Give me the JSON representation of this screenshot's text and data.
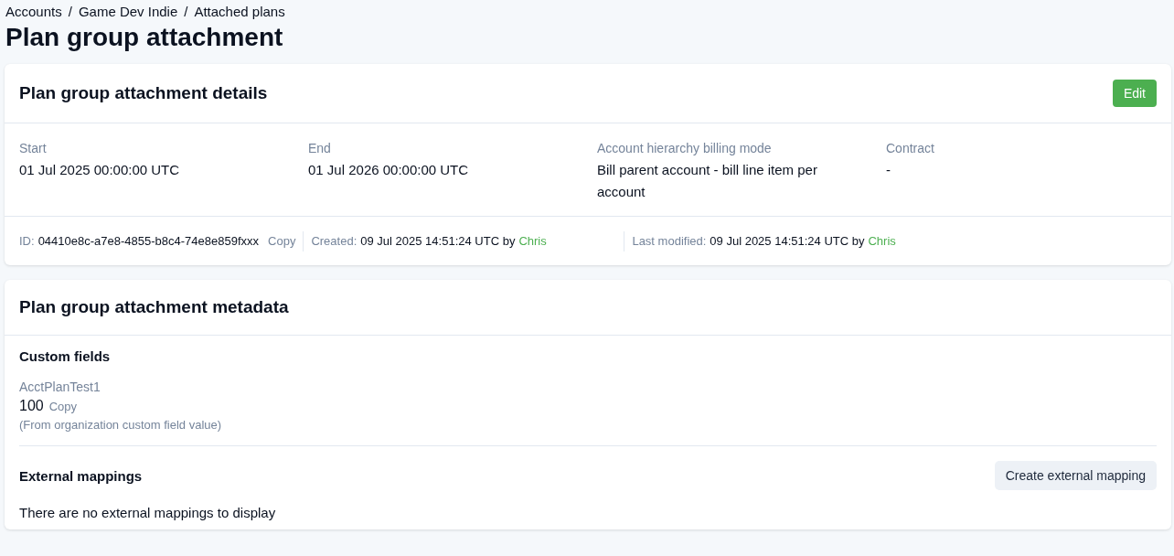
{
  "breadcrumb": {
    "separator": "/",
    "items": [
      {
        "label": "Accounts"
      },
      {
        "label": "Game Dev Indie"
      },
      {
        "label": "Attached plans"
      }
    ]
  },
  "page_title": "Plan group attachment",
  "details": {
    "title": "Plan group attachment details",
    "edit_button": "Edit",
    "fields": [
      {
        "label": "Start",
        "value": "01 Jul 2025 00:00:00 UTC"
      },
      {
        "label": "End",
        "value": "01 Jul 2026 00:00:00 UTC"
      },
      {
        "label": "Account hierarchy billing mode",
        "value": "Bill parent account - bill line item per account"
      },
      {
        "label": "Contract",
        "value": "-"
      }
    ],
    "meta": {
      "id_label": "ID:",
      "id_value": "04410e8c-a7e8-4855-b8c4-74e8e859fxxx",
      "copy": "Copy",
      "created_label": "Created:",
      "created_value": "09 Jul 2025 14:51:24 UTC by",
      "created_by": "Chris",
      "modified_label": "Last modified:",
      "modified_value": "09 Jul 2025 14:51:24 UTC by",
      "modified_by": "Chris"
    }
  },
  "metadata": {
    "title": "Plan group attachment metadata",
    "custom_fields_title": "Custom fields",
    "custom_fields": [
      {
        "name": "AcctPlanTest1",
        "value": "100",
        "copy": "Copy",
        "note": "(From organization custom field value)"
      }
    ],
    "external_mappings_title": "External mappings",
    "create_button": "Create external mapping",
    "empty_message": "There are no external mappings to display"
  }
}
